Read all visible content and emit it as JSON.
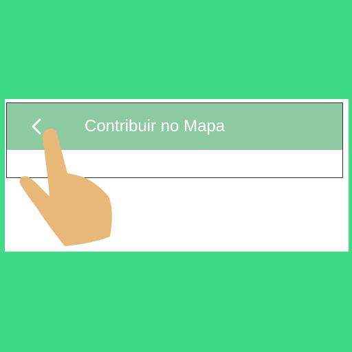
{
  "app_bar": {
    "title": "Contribuir no Mapa",
    "back_icon": "chevron-left-icon",
    "background_color": "#8dc9a1",
    "text_color": "#ffffff"
  },
  "page": {
    "background_color": "#3fdb85"
  },
  "overlay": {
    "icon": "pointing-hand-icon",
    "skin_color": "#e8b878"
  }
}
